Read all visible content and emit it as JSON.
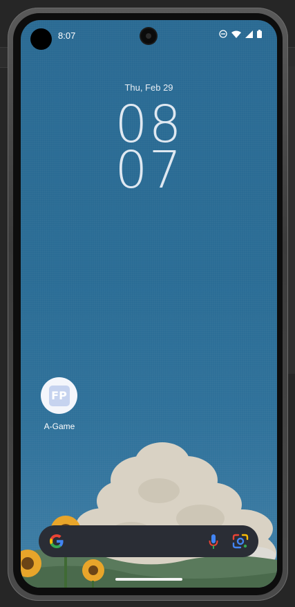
{
  "status_bar": {
    "time": "8:07",
    "icons": [
      "do-not-disturb-icon",
      "wifi-icon",
      "signal-icon",
      "battery-icon"
    ]
  },
  "lock_clock": {
    "date": "Thu, Feb 29",
    "hour": "08",
    "minute": "07"
  },
  "home": {
    "apps": [
      {
        "label": "A-Game",
        "icon_text": "FP",
        "icon": "fp-app-icon"
      }
    ]
  },
  "search_bar": {
    "icons": [
      "google-g-icon",
      "microphone-icon",
      "google-lens-icon"
    ]
  },
  "colors": {
    "wallpaper_sky": "#2a6a93",
    "search_bar_bg": "#2a2d35",
    "clock_text": "#dfe8f1"
  }
}
